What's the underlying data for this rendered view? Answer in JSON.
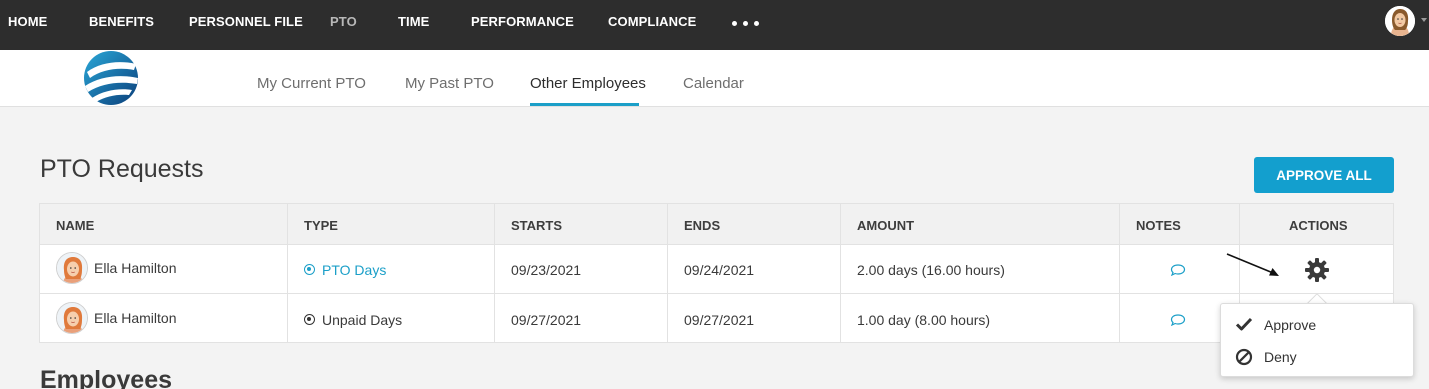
{
  "topnav": {
    "items": [
      {
        "label": "HOME"
      },
      {
        "label": "BENEFITS"
      },
      {
        "label": "PERSONNEL FILE"
      },
      {
        "label": "PTO"
      },
      {
        "label": "TIME"
      },
      {
        "label": "PERFORMANCE"
      },
      {
        "label": "COMPLIANCE"
      }
    ],
    "more_icon": "more-dots-icon",
    "avatar_icon": "user-avatar-icon"
  },
  "subnav": {
    "tabs": [
      {
        "label": "My Current PTO"
      },
      {
        "label": "My Past PTO"
      },
      {
        "label": "Other Employees",
        "active": true
      },
      {
        "label": "Calendar"
      }
    ]
  },
  "pto": {
    "title": "PTO Requests",
    "approve_all": "APPROVE ALL",
    "columns": [
      "NAME",
      "TYPE",
      "STARTS",
      "ENDS",
      "AMOUNT",
      "NOTES",
      "ACTIONS"
    ],
    "rows": [
      {
        "name": "Ella Hamilton",
        "type": "PTO Days",
        "starts": "09/23/2021",
        "ends": "09/24/2021",
        "amount": "2.00 days (16.00 hours)"
      },
      {
        "name": "Ella Hamilton",
        "type": "Unpaid Days",
        "starts": "09/27/2021",
        "ends": "09/27/2021",
        "amount": "1.00 day (8.00 hours)"
      }
    ]
  },
  "actions_menu": {
    "items": [
      {
        "label": "Approve",
        "icon": "check-icon"
      },
      {
        "label": "Deny",
        "icon": "block-icon"
      }
    ]
  },
  "employees": {
    "title": "Employees"
  },
  "colors": {
    "accent": "#1b9fc8",
    "topbar": "#2d2d2d",
    "button": "#139fce"
  }
}
